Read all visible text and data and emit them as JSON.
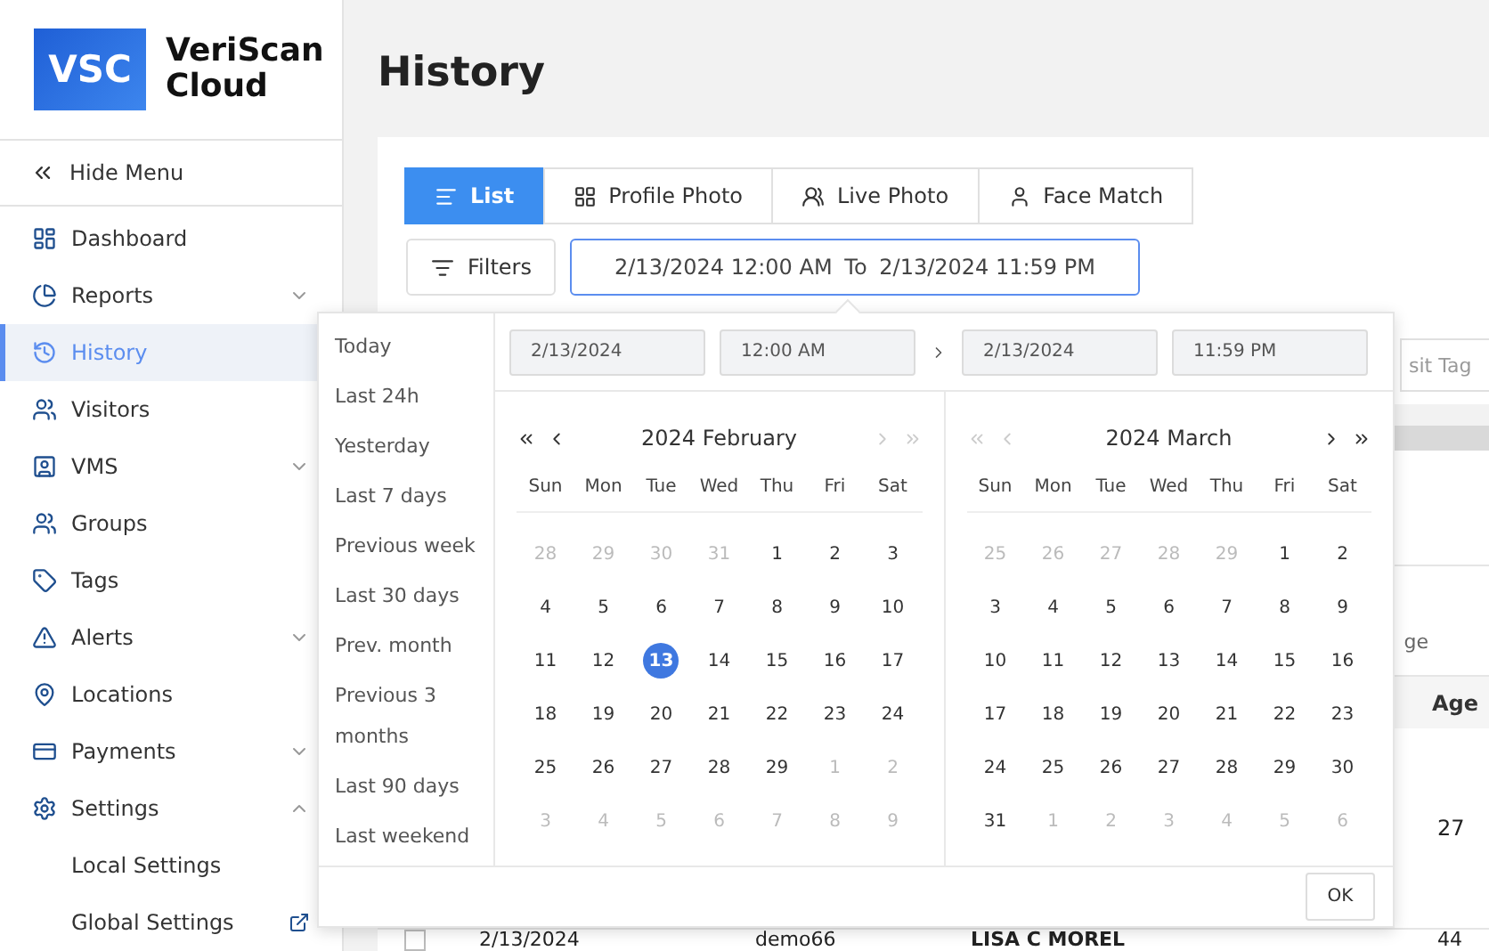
{
  "sidebar": {
    "logo_mark": "VSC",
    "logo_name": "VeriScan Cloud",
    "hide_menu": "Hide Menu",
    "items": [
      {
        "label": "Dashboard",
        "kind": "link",
        "selected": false
      },
      {
        "label": "Reports",
        "kind": "group",
        "expanded": false,
        "selected": false
      },
      {
        "label": "History",
        "kind": "link",
        "selected": true
      },
      {
        "label": "Visitors",
        "kind": "link",
        "selected": false
      },
      {
        "label": "VMS",
        "kind": "group",
        "expanded": false,
        "selected": false
      },
      {
        "label": "Groups",
        "kind": "link",
        "selected": false
      },
      {
        "label": "Tags",
        "kind": "link",
        "selected": false
      },
      {
        "label": "Alerts",
        "kind": "group",
        "expanded": false,
        "selected": false
      },
      {
        "label": "Locations",
        "kind": "link",
        "selected": false
      },
      {
        "label": "Payments",
        "kind": "group",
        "expanded": false,
        "selected": false
      },
      {
        "label": "Settings",
        "kind": "group",
        "expanded": true,
        "selected": false,
        "children": [
          {
            "label": "Local Settings",
            "external": false
          },
          {
            "label": "Global Settings",
            "external": true
          }
        ]
      }
    ]
  },
  "page_title": "History",
  "view_tabs": [
    {
      "label": "List",
      "selected": true
    },
    {
      "label": "Profile Photo",
      "selected": false
    },
    {
      "label": "Live Photo",
      "selected": false
    },
    {
      "label": "Face Match",
      "selected": false
    }
  ],
  "filters_button": "Filters",
  "date_range": {
    "start": "2/13/2024 12:00 AM",
    "separator": "To",
    "end": "2/13/2024 11:59 PM"
  },
  "background": {
    "field_text": "sit Tag",
    "header_fragment": "ge",
    "age_header": "Age",
    "rows": [
      {
        "age": "27"
      },
      {
        "checked": false,
        "date": "2/13/2024",
        "user": "demo66",
        "name": "LISA C MOREL",
        "age": "44"
      }
    ]
  },
  "picker": {
    "presets": [
      "Today",
      "Last 24h",
      "Yesterday",
      "Last 7 days",
      "Previous week",
      "Last 30 days",
      "Prev. month",
      "Previous 3 months",
      "Last 90 days",
      "Last weekend"
    ],
    "start_date": "2/13/2024",
    "start_time": "12:00 AM",
    "end_date": "2/13/2024",
    "end_time": "11:59 PM",
    "calendars": [
      {
        "title": "2024 February",
        "prev_disabled": false,
        "next_disabled": true,
        "weekdays": [
          "Sun",
          "Mon",
          "Tue",
          "Wed",
          "Thu",
          "Fri",
          "Sat"
        ],
        "weeks": [
          [
            {
              "label": "28",
              "in_month": false,
              "selected": false
            },
            {
              "label": "29",
              "in_month": false,
              "selected": false
            },
            {
              "label": "30",
              "in_month": false,
              "selected": false
            },
            {
              "label": "31",
              "in_month": false,
              "selected": false
            },
            {
              "label": "1",
              "in_month": true,
              "selected": false
            },
            {
              "label": "2",
              "in_month": true,
              "selected": false
            },
            {
              "label": "3",
              "in_month": true,
              "selected": false
            }
          ],
          [
            {
              "label": "4",
              "in_month": true,
              "selected": false
            },
            {
              "label": "5",
              "in_month": true,
              "selected": false
            },
            {
              "label": "6",
              "in_month": true,
              "selected": false
            },
            {
              "label": "7",
              "in_month": true,
              "selected": false
            },
            {
              "label": "8",
              "in_month": true,
              "selected": false
            },
            {
              "label": "9",
              "in_month": true,
              "selected": false
            },
            {
              "label": "10",
              "in_month": true,
              "selected": false
            }
          ],
          [
            {
              "label": "11",
              "in_month": true,
              "selected": false
            },
            {
              "label": "12",
              "in_month": true,
              "selected": false
            },
            {
              "label": "13",
              "in_month": true,
              "selected": true
            },
            {
              "label": "14",
              "in_month": true,
              "selected": false
            },
            {
              "label": "15",
              "in_month": true,
              "selected": false
            },
            {
              "label": "16",
              "in_month": true,
              "selected": false
            },
            {
              "label": "17",
              "in_month": true,
              "selected": false
            }
          ],
          [
            {
              "label": "18",
              "in_month": true,
              "selected": false
            },
            {
              "label": "19",
              "in_month": true,
              "selected": false
            },
            {
              "label": "20",
              "in_month": true,
              "selected": false
            },
            {
              "label": "21",
              "in_month": true,
              "selected": false
            },
            {
              "label": "22",
              "in_month": true,
              "selected": false
            },
            {
              "label": "23",
              "in_month": true,
              "selected": false
            },
            {
              "label": "24",
              "in_month": true,
              "selected": false
            }
          ],
          [
            {
              "label": "25",
              "in_month": true,
              "selected": false
            },
            {
              "label": "26",
              "in_month": true,
              "selected": false
            },
            {
              "label": "27",
              "in_month": true,
              "selected": false
            },
            {
              "label": "28",
              "in_month": true,
              "selected": false
            },
            {
              "label": "29",
              "in_month": true,
              "selected": false
            },
            {
              "label": "1",
              "in_month": false,
              "selected": false
            },
            {
              "label": "2",
              "in_month": false,
              "selected": false
            }
          ],
          [
            {
              "label": "3",
              "in_month": false,
              "selected": false
            },
            {
              "label": "4",
              "in_month": false,
              "selected": false
            },
            {
              "label": "5",
              "in_month": false,
              "selected": false
            },
            {
              "label": "6",
              "in_month": false,
              "selected": false
            },
            {
              "label": "7",
              "in_month": false,
              "selected": false
            },
            {
              "label": "8",
              "in_month": false,
              "selected": false
            },
            {
              "label": "9",
              "in_month": false,
              "selected": false
            }
          ]
        ]
      },
      {
        "title": "2024 March",
        "prev_disabled": true,
        "next_disabled": false,
        "weekdays": [
          "Sun",
          "Mon",
          "Tue",
          "Wed",
          "Thu",
          "Fri",
          "Sat"
        ],
        "weeks": [
          [
            {
              "label": "25",
              "in_month": false,
              "selected": false
            },
            {
              "label": "26",
              "in_month": false,
              "selected": false
            },
            {
              "label": "27",
              "in_month": false,
              "selected": false
            },
            {
              "label": "28",
              "in_month": false,
              "selected": false
            },
            {
              "label": "29",
              "in_month": false,
              "selected": false
            },
            {
              "label": "1",
              "in_month": true,
              "selected": false
            },
            {
              "label": "2",
              "in_month": true,
              "selected": false
            }
          ],
          [
            {
              "label": "3",
              "in_month": true,
              "selected": false
            },
            {
              "label": "4",
              "in_month": true,
              "selected": false
            },
            {
              "label": "5",
              "in_month": true,
              "selected": false
            },
            {
              "label": "6",
              "in_month": true,
              "selected": false
            },
            {
              "label": "7",
              "in_month": true,
              "selected": false
            },
            {
              "label": "8",
              "in_month": true,
              "selected": false
            },
            {
              "label": "9",
              "in_month": true,
              "selected": false
            }
          ],
          [
            {
              "label": "10",
              "in_month": true,
              "selected": false
            },
            {
              "label": "11",
              "in_month": true,
              "selected": false
            },
            {
              "label": "12",
              "in_month": true,
              "selected": false
            },
            {
              "label": "13",
              "in_month": true,
              "selected": false
            },
            {
              "label": "14",
              "in_month": true,
              "selected": false
            },
            {
              "label": "15",
              "in_month": true,
              "selected": false
            },
            {
              "label": "16",
              "in_month": true,
              "selected": false
            }
          ],
          [
            {
              "label": "17",
              "in_month": true,
              "selected": false
            },
            {
              "label": "18",
              "in_month": true,
              "selected": false
            },
            {
              "label": "19",
              "in_month": true,
              "selected": false
            },
            {
              "label": "20",
              "in_month": true,
              "selected": false
            },
            {
              "label": "21",
              "in_month": true,
              "selected": false
            },
            {
              "label": "22",
              "in_month": true,
              "selected": false
            },
            {
              "label": "23",
              "in_month": true,
              "selected": false
            }
          ],
          [
            {
              "label": "24",
              "in_month": true,
              "selected": false
            },
            {
              "label": "25",
              "in_month": true,
              "selected": false
            },
            {
              "label": "26",
              "in_month": true,
              "selected": false
            },
            {
              "label": "27",
              "in_month": true,
              "selected": false
            },
            {
              "label": "28",
              "in_month": true,
              "selected": false
            },
            {
              "label": "29",
              "in_month": true,
              "selected": false
            },
            {
              "label": "30",
              "in_month": true,
              "selected": false
            }
          ],
          [
            {
              "label": "31",
              "in_month": true,
              "selected": false
            },
            {
              "label": "1",
              "in_month": false,
              "selected": false
            },
            {
              "label": "2",
              "in_month": false,
              "selected": false
            },
            {
              "label": "3",
              "in_month": false,
              "selected": false
            },
            {
              "label": "4",
              "in_month": false,
              "selected": false
            },
            {
              "label": "5",
              "in_month": false,
              "selected": false
            },
            {
              "label": "6",
              "in_month": false,
              "selected": false
            }
          ]
        ]
      }
    ],
    "ok_button": "OK"
  }
}
